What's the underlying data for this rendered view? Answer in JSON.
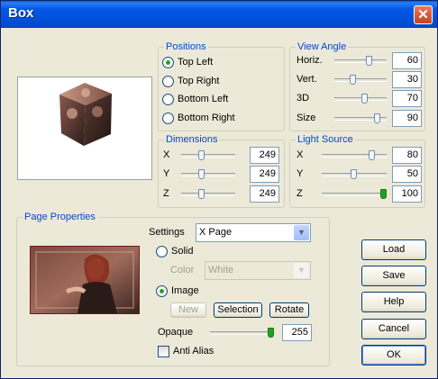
{
  "window": {
    "title": "Box"
  },
  "positions": {
    "title": "Positions",
    "options": [
      "Top Left",
      "Top Right",
      "Bottom Left",
      "Bottom Right"
    ],
    "selected": "Top Left"
  },
  "view_angle": {
    "title": "View Angle",
    "rows": [
      {
        "label": "Horiz.",
        "value": "60",
        "level": 0.6
      },
      {
        "label": "Vert.",
        "value": "30",
        "level": 0.3
      },
      {
        "label": "3D",
        "value": "70",
        "level": 0.55
      },
      {
        "label": "Size",
        "value": "90",
        "level": 0.75
      }
    ]
  },
  "dimensions": {
    "title": "Dimensions",
    "rows": [
      {
        "label": "X",
        "value": "249"
      },
      {
        "label": "Y",
        "value": "249"
      },
      {
        "label": "Z",
        "value": "249"
      }
    ]
  },
  "light_source": {
    "title": "Light Source",
    "rows": [
      {
        "label": "X",
        "value": "80"
      },
      {
        "label": "Y",
        "value": "50"
      },
      {
        "label": "Z",
        "value": "100"
      }
    ]
  },
  "page_properties": {
    "title": "Page Properties",
    "settings_label": "Settings",
    "settings_value": "X Page",
    "solid_label": "Solid",
    "color_label": "Color",
    "color_value": "White",
    "image_label": "Image",
    "new_label": "New",
    "selection_label": "Selection",
    "rotate_label": "Rotate",
    "opaque_label": "Opaque",
    "opaque_value": "255",
    "anti_alias_label": "Anti Alias",
    "mode": "Image"
  },
  "buttons": {
    "load": "Load",
    "save": "Save",
    "help": "Help",
    "cancel": "Cancel",
    "ok": "OK"
  },
  "icons": {
    "close": "close-icon",
    "dropdown": "chevron-down-icon"
  },
  "colors": {
    "title_bar": "#0058e6",
    "group_title": "#0046d5",
    "window_bg": "#ece9d8"
  }
}
